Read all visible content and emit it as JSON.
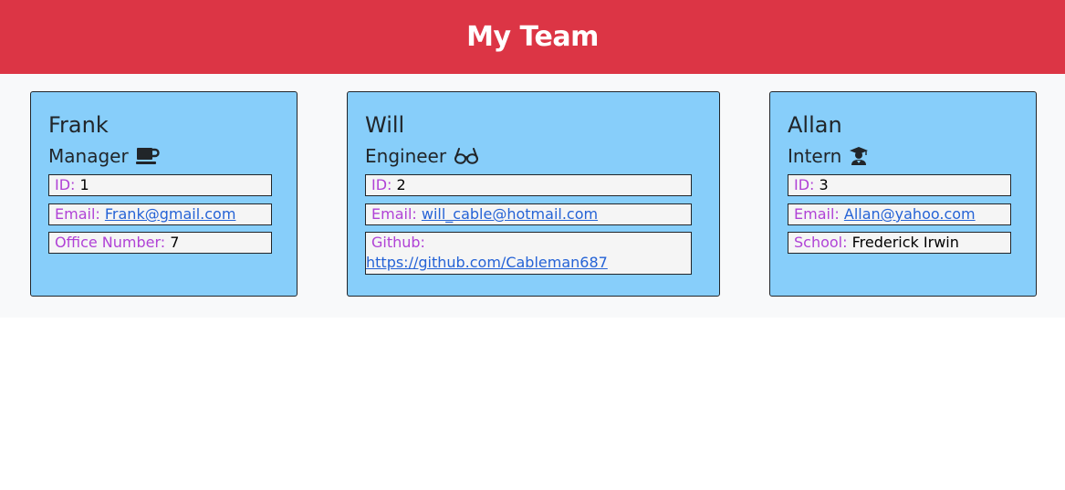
{
  "header": {
    "title": "My Team"
  },
  "cards": [
    {
      "name": "Frank",
      "role": "Manager",
      "role_icon": "coffee-cup-icon",
      "fields": [
        {
          "label": "ID:",
          "value": "1"
        },
        {
          "label": "Email:",
          "value": "Frank@gmail.com"
        },
        {
          "label": "Office Number:",
          "value": "7"
        }
      ]
    },
    {
      "name": "Will",
      "role": "Engineer",
      "role_icon": "glasses-icon",
      "fields": [
        {
          "label": "ID:",
          "value": "2"
        },
        {
          "label": "Email:",
          "value": "will_cable@hotmail.com"
        },
        {
          "label": "Github:",
          "value": "https://github.com/Cableman687"
        }
      ]
    },
    {
      "name": "Allan",
      "role": "Intern",
      "role_icon": "graduate-icon",
      "fields": [
        {
          "label": "ID:",
          "value": "3"
        },
        {
          "label": "Email:",
          "value": "Allan@yahoo.com"
        },
        {
          "label": "School:",
          "value": "Frederick Irwin"
        }
      ]
    }
  ],
  "colors": {
    "header_bg": "#dc3545",
    "card_bg": "#87cefa",
    "label": "#b042d6",
    "link": "#2563d6"
  }
}
